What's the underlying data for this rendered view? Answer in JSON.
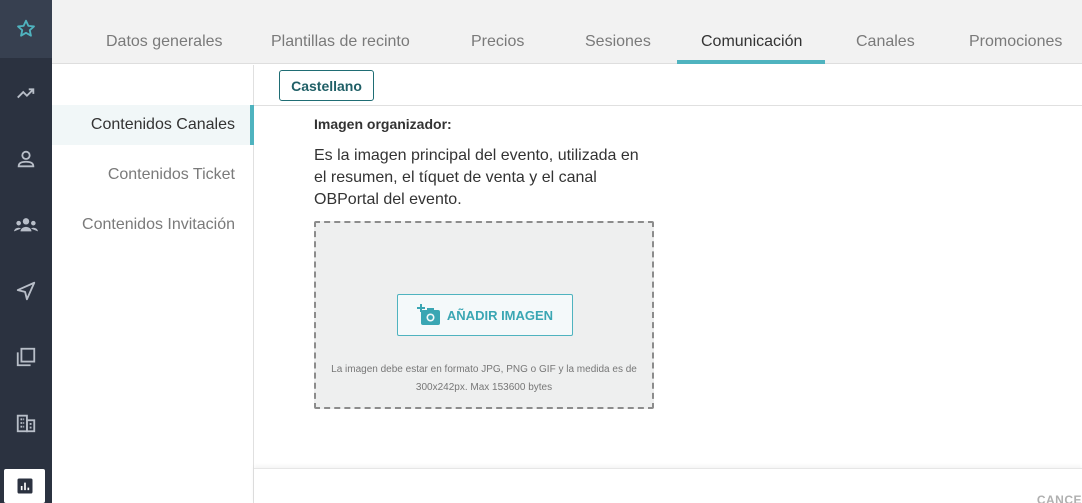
{
  "nav_rail": {
    "items": [
      {
        "icon": "star-icon"
      },
      {
        "icon": "trending-up-icon"
      },
      {
        "icon": "person-icon"
      },
      {
        "icon": "group-icon"
      },
      {
        "icon": "send-icon"
      },
      {
        "icon": "copy-icon"
      },
      {
        "icon": "building-icon"
      },
      {
        "icon": "bar-chart-icon"
      }
    ],
    "accent_color": "#4fb3bf"
  },
  "tabs": [
    {
      "label": "Datos generales"
    },
    {
      "label": "Plantillas de recinto"
    },
    {
      "label": "Precios"
    },
    {
      "label": "Sesiones"
    },
    {
      "label": "Comunicación",
      "active": true
    },
    {
      "label": "Canales"
    },
    {
      "label": "Promociones"
    }
  ],
  "language": {
    "selected": "Castellano"
  },
  "subnav": [
    {
      "label": "Contenidos Canales",
      "active": true
    },
    {
      "label": "Contenidos Ticket"
    },
    {
      "label": "Contenidos Invitación"
    }
  ],
  "main": {
    "section_label": "Imagen organizador:",
    "description": "Es la imagen principal del evento, utilizada en el resumen, el tíquet de venta y el canal OBPortal del evento.",
    "add_image_label": "AÑADIR IMAGEN",
    "hint_line1": "La imagen debe estar en formato JPG, PNG o GIF y la medida es de",
    "hint_line2": "300x242px. Max 153600 bytes"
  },
  "footer": {
    "cancel_label": "CANCE"
  }
}
